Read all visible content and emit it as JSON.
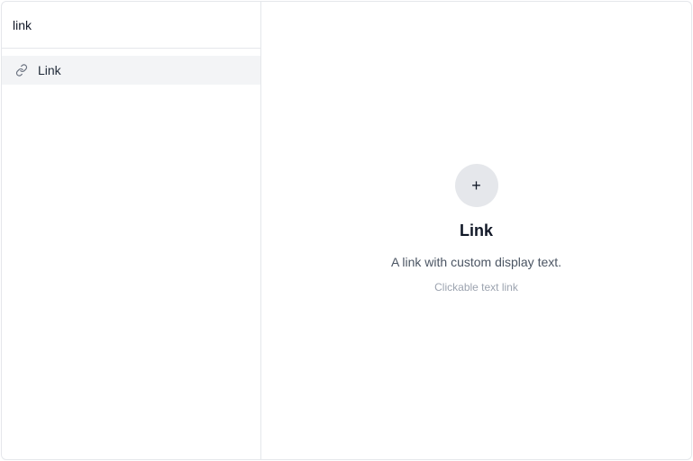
{
  "search": {
    "value": "link"
  },
  "results": [
    {
      "label": "Link",
      "icon": "link-icon"
    }
  ],
  "detail": {
    "add_icon": "+",
    "title": "Link",
    "description": "A link with custom display text.",
    "subtitle": "Clickable text link"
  },
  "colors": {
    "border": "#e5e7eb",
    "selected_bg": "#f3f4f6",
    "icon_circle_bg": "#e5e7eb",
    "muted_text": "#9ca3af"
  }
}
